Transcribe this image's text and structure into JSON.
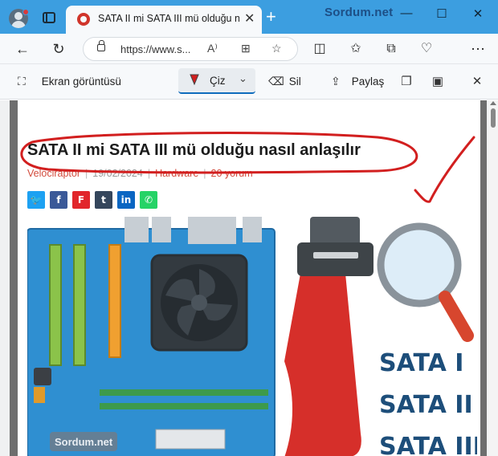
{
  "browser": {
    "tab_title": "SATA II mi SATA III mü olduğu nasıl anlaşılır",
    "brand_watermark": "Sordum.net",
    "url": "https://www.s..."
  },
  "capture_toolbar": {
    "screenshot_label": "Ekran görüntüsü",
    "draw_label": "Çiz",
    "erase_label": "Sil",
    "share_label": "Paylaş"
  },
  "article": {
    "title": "SATA II mi SATA III mü olduğu nasıl anlaşılır",
    "author": "Velociraptor",
    "date": "19/02/2024",
    "category": "Hardware",
    "comments": "20 yorum",
    "share_buttons": [
      "twitter",
      "facebook",
      "flipboard",
      "tumblr",
      "linkedin",
      "whatsapp"
    ]
  },
  "image": {
    "watermark": "Sordum.net",
    "labels": [
      "SATA I",
      "SATA II",
      "SATA III"
    ]
  },
  "colors": {
    "titlebar": "#3c9ee0",
    "accent_red": "#d24b3c",
    "ink_red": "#d21f1f"
  }
}
